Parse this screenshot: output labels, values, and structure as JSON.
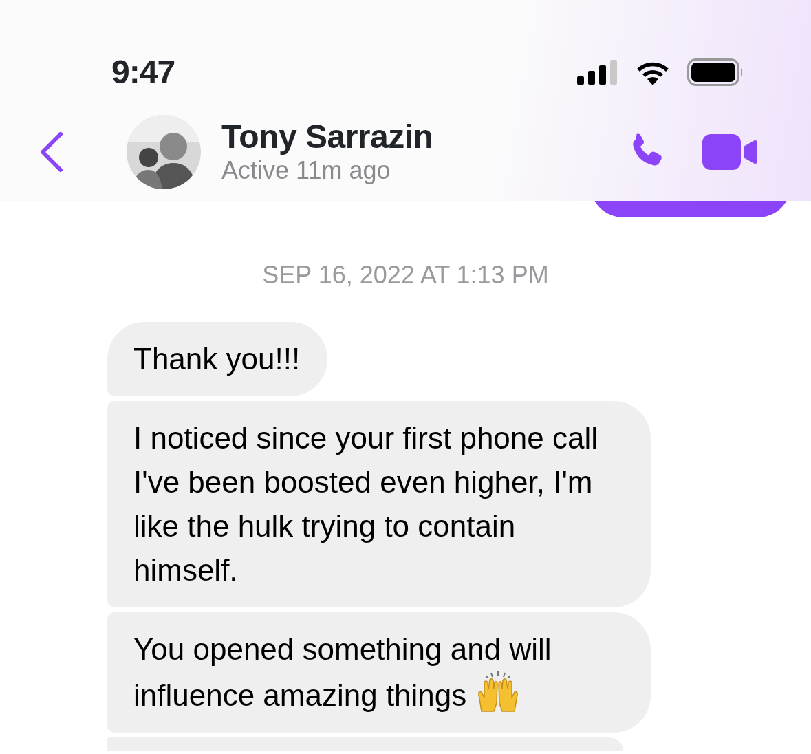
{
  "status_bar": {
    "time": "9:47"
  },
  "header": {
    "name": "Tony Sarrazin",
    "status": "Active 11m ago"
  },
  "messages": [
    {
      "kind": "sent"
    },
    {
      "kind": "timestamp",
      "text": "SEP 16, 2022 AT 1:13 PM"
    },
    {
      "kind": "received",
      "text": "Thank you!!!"
    },
    {
      "kind": "received",
      "text": "I noticed since your first phone call I've been boosted even higher, I'm like the hulk trying to contain himself."
    },
    {
      "kind": "received",
      "text": "You opened something and will influence amazing things",
      "emoji": true
    },
    {
      "kind": "received"
    }
  ]
}
